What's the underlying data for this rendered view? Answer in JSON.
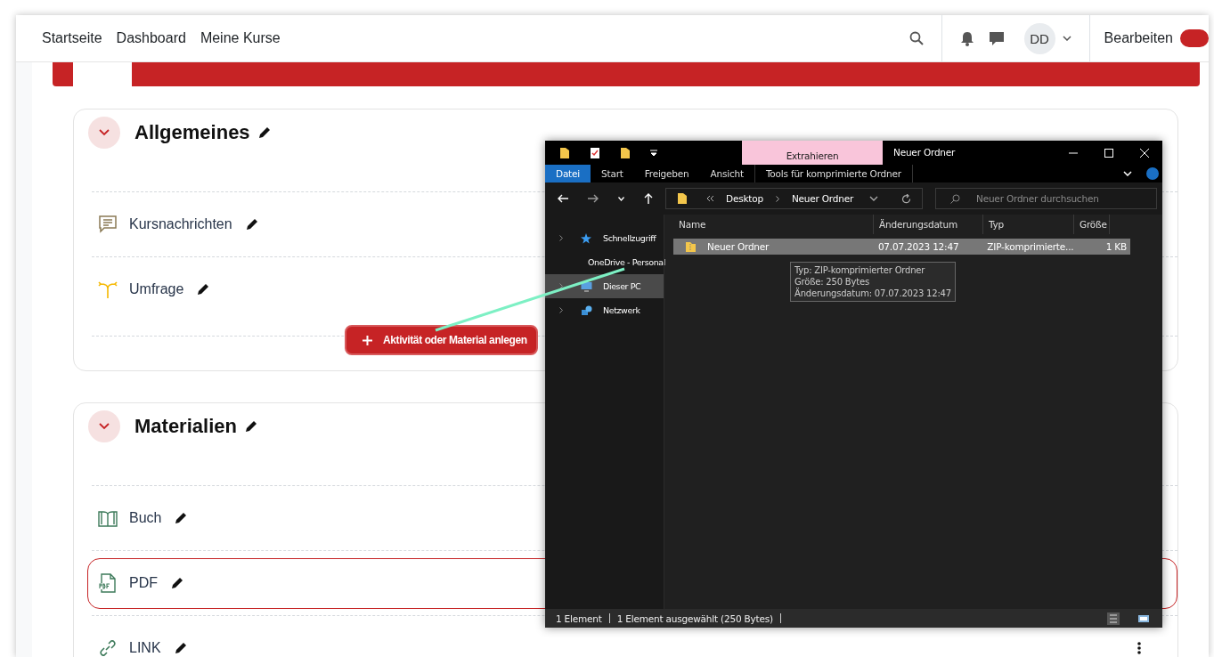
{
  "nav": {
    "links": [
      {
        "label": "Startseite"
      },
      {
        "label": "Dashboard"
      },
      {
        "label": "Meine Kurse"
      }
    ],
    "avatar": "DD",
    "edit_label": "Bearbeiten",
    "edit_mode": true
  },
  "sections": [
    {
      "title": "Allgemeines",
      "expanded": true,
      "items": [
        {
          "kind": "forum",
          "label": "Kursnachrichten",
          "highlighted": false
        },
        {
          "kind": "choice",
          "label": "Umfrage",
          "highlighted": false
        }
      ],
      "add_button": "Aktivität oder Material anlegen"
    },
    {
      "title": "Materialien",
      "expanded": true,
      "items": [
        {
          "kind": "book",
          "label": "Buch",
          "highlighted": false
        },
        {
          "kind": "pdf",
          "label": "PDF",
          "highlighted": true
        },
        {
          "kind": "link",
          "label": "LINK",
          "highlighted": false
        }
      ]
    }
  ],
  "explorer": {
    "context_tab": "Extrahieren",
    "title": "Neuer Ordner",
    "ribbon_tabs": [
      {
        "kind": "file-menu",
        "label": "Datei"
      },
      {
        "kind": "tab",
        "label": "Start"
      },
      {
        "kind": "tab",
        "label": "Freigeben"
      },
      {
        "kind": "tab",
        "label": "Ansicht"
      },
      {
        "kind": "context-tab",
        "label": "Tools für komprimierte Ordner"
      }
    ],
    "path": [
      "Desktop",
      "Neuer Ordner"
    ],
    "search_placeholder": "Neuer Ordner durchsuchen",
    "nav": [
      {
        "kind": "star",
        "label": "Schnellzugriff",
        "selected": false
      },
      {
        "kind": "cloud",
        "label": "OneDrive - Personal",
        "selected": false
      },
      {
        "kind": "pc",
        "label": "Dieser PC",
        "selected": true
      },
      {
        "kind": "network",
        "label": "Netzwerk",
        "selected": false
      }
    ],
    "columns": [
      "Name",
      "Änderungsdatum",
      "Typ",
      "Größe"
    ],
    "rows": [
      {
        "cells": [
          "Neuer Ordner",
          "07.07.2023 12:47",
          "ZIP-komprimierte...",
          "1 KB"
        ],
        "selected": true
      }
    ],
    "tooltip": [
      "Typ: ZIP-komprimierter Ordner",
      "Größe: 250 Bytes",
      "Änderungsdatum: 07.07.2023 12:47"
    ],
    "status": [
      "1 Element",
      "1 Element ausgewählt (250 Bytes)"
    ]
  }
}
